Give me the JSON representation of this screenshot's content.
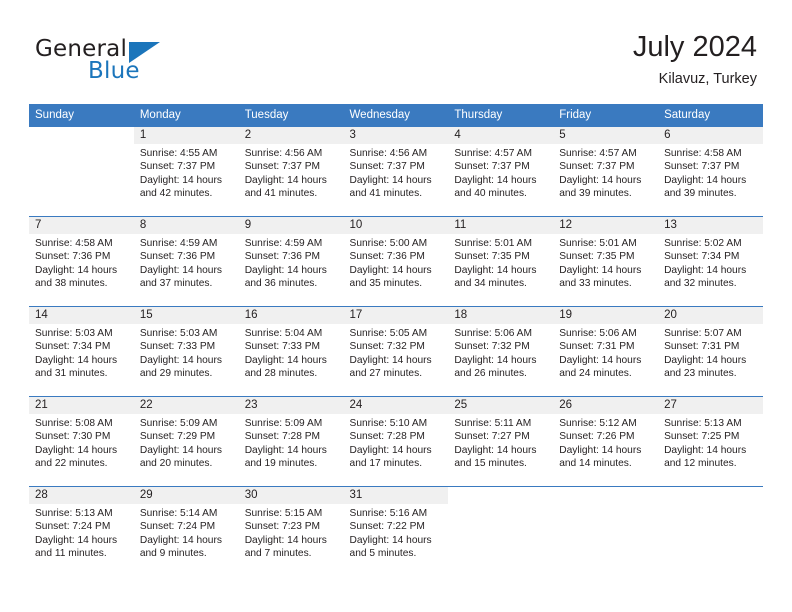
{
  "brand": {
    "word1": "General",
    "word2": "Blue",
    "triangle_color": "#1b75bb"
  },
  "header": {
    "title": "July 2024",
    "location": "Kilavuz, Turkey"
  },
  "theme": {
    "header_blue": "#3a7ac0",
    "daynum_band": "#f0f0f0",
    "text": "#231f20"
  },
  "weekday_headers": [
    "Sunday",
    "Monday",
    "Tuesday",
    "Wednesday",
    "Thursday",
    "Friday",
    "Saturday"
  ],
  "weeks": [
    [
      {
        "day": "",
        "sunrise": "",
        "sunset": "",
        "daylight1": "",
        "daylight2": ""
      },
      {
        "day": "1",
        "sunrise": "Sunrise: 4:55 AM",
        "sunset": "Sunset: 7:37 PM",
        "daylight1": "Daylight: 14 hours",
        "daylight2": "and 42 minutes."
      },
      {
        "day": "2",
        "sunrise": "Sunrise: 4:56 AM",
        "sunset": "Sunset: 7:37 PM",
        "daylight1": "Daylight: 14 hours",
        "daylight2": "and 41 minutes."
      },
      {
        "day": "3",
        "sunrise": "Sunrise: 4:56 AM",
        "sunset": "Sunset: 7:37 PM",
        "daylight1": "Daylight: 14 hours",
        "daylight2": "and 41 minutes."
      },
      {
        "day": "4",
        "sunrise": "Sunrise: 4:57 AM",
        "sunset": "Sunset: 7:37 PM",
        "daylight1": "Daylight: 14 hours",
        "daylight2": "and 40 minutes."
      },
      {
        "day": "5",
        "sunrise": "Sunrise: 4:57 AM",
        "sunset": "Sunset: 7:37 PM",
        "daylight1": "Daylight: 14 hours",
        "daylight2": "and 39 minutes."
      },
      {
        "day": "6",
        "sunrise": "Sunrise: 4:58 AM",
        "sunset": "Sunset: 7:37 PM",
        "daylight1": "Daylight: 14 hours",
        "daylight2": "and 39 minutes."
      }
    ],
    [
      {
        "day": "7",
        "sunrise": "Sunrise: 4:58 AM",
        "sunset": "Sunset: 7:36 PM",
        "daylight1": "Daylight: 14 hours",
        "daylight2": "and 38 minutes."
      },
      {
        "day": "8",
        "sunrise": "Sunrise: 4:59 AM",
        "sunset": "Sunset: 7:36 PM",
        "daylight1": "Daylight: 14 hours",
        "daylight2": "and 37 minutes."
      },
      {
        "day": "9",
        "sunrise": "Sunrise: 4:59 AM",
        "sunset": "Sunset: 7:36 PM",
        "daylight1": "Daylight: 14 hours",
        "daylight2": "and 36 minutes."
      },
      {
        "day": "10",
        "sunrise": "Sunrise: 5:00 AM",
        "sunset": "Sunset: 7:36 PM",
        "daylight1": "Daylight: 14 hours",
        "daylight2": "and 35 minutes."
      },
      {
        "day": "11",
        "sunrise": "Sunrise: 5:01 AM",
        "sunset": "Sunset: 7:35 PM",
        "daylight1": "Daylight: 14 hours",
        "daylight2": "and 34 minutes."
      },
      {
        "day": "12",
        "sunrise": "Sunrise: 5:01 AM",
        "sunset": "Sunset: 7:35 PM",
        "daylight1": "Daylight: 14 hours",
        "daylight2": "and 33 minutes."
      },
      {
        "day": "13",
        "sunrise": "Sunrise: 5:02 AM",
        "sunset": "Sunset: 7:34 PM",
        "daylight1": "Daylight: 14 hours",
        "daylight2": "and 32 minutes."
      }
    ],
    [
      {
        "day": "14",
        "sunrise": "Sunrise: 5:03 AM",
        "sunset": "Sunset: 7:34 PM",
        "daylight1": "Daylight: 14 hours",
        "daylight2": "and 31 minutes."
      },
      {
        "day": "15",
        "sunrise": "Sunrise: 5:03 AM",
        "sunset": "Sunset: 7:33 PM",
        "daylight1": "Daylight: 14 hours",
        "daylight2": "and 29 minutes."
      },
      {
        "day": "16",
        "sunrise": "Sunrise: 5:04 AM",
        "sunset": "Sunset: 7:33 PM",
        "daylight1": "Daylight: 14 hours",
        "daylight2": "and 28 minutes."
      },
      {
        "day": "17",
        "sunrise": "Sunrise: 5:05 AM",
        "sunset": "Sunset: 7:32 PM",
        "daylight1": "Daylight: 14 hours",
        "daylight2": "and 27 minutes."
      },
      {
        "day": "18",
        "sunrise": "Sunrise: 5:06 AM",
        "sunset": "Sunset: 7:32 PM",
        "daylight1": "Daylight: 14 hours",
        "daylight2": "and 26 minutes."
      },
      {
        "day": "19",
        "sunrise": "Sunrise: 5:06 AM",
        "sunset": "Sunset: 7:31 PM",
        "daylight1": "Daylight: 14 hours",
        "daylight2": "and 24 minutes."
      },
      {
        "day": "20",
        "sunrise": "Sunrise: 5:07 AM",
        "sunset": "Sunset: 7:31 PM",
        "daylight1": "Daylight: 14 hours",
        "daylight2": "and 23 minutes."
      }
    ],
    [
      {
        "day": "21",
        "sunrise": "Sunrise: 5:08 AM",
        "sunset": "Sunset: 7:30 PM",
        "daylight1": "Daylight: 14 hours",
        "daylight2": "and 22 minutes."
      },
      {
        "day": "22",
        "sunrise": "Sunrise: 5:09 AM",
        "sunset": "Sunset: 7:29 PM",
        "daylight1": "Daylight: 14 hours",
        "daylight2": "and 20 minutes."
      },
      {
        "day": "23",
        "sunrise": "Sunrise: 5:09 AM",
        "sunset": "Sunset: 7:28 PM",
        "daylight1": "Daylight: 14 hours",
        "daylight2": "and 19 minutes."
      },
      {
        "day": "24",
        "sunrise": "Sunrise: 5:10 AM",
        "sunset": "Sunset: 7:28 PM",
        "daylight1": "Daylight: 14 hours",
        "daylight2": "and 17 minutes."
      },
      {
        "day": "25",
        "sunrise": "Sunrise: 5:11 AM",
        "sunset": "Sunset: 7:27 PM",
        "daylight1": "Daylight: 14 hours",
        "daylight2": "and 15 minutes."
      },
      {
        "day": "26",
        "sunrise": "Sunrise: 5:12 AM",
        "sunset": "Sunset: 7:26 PM",
        "daylight1": "Daylight: 14 hours",
        "daylight2": "and 14 minutes."
      },
      {
        "day": "27",
        "sunrise": "Sunrise: 5:13 AM",
        "sunset": "Sunset: 7:25 PM",
        "daylight1": "Daylight: 14 hours",
        "daylight2": "and 12 minutes."
      }
    ],
    [
      {
        "day": "28",
        "sunrise": "Sunrise: 5:13 AM",
        "sunset": "Sunset: 7:24 PM",
        "daylight1": "Daylight: 14 hours",
        "daylight2": "and 11 minutes."
      },
      {
        "day": "29",
        "sunrise": "Sunrise: 5:14 AM",
        "sunset": "Sunset: 7:24 PM",
        "daylight1": "Daylight: 14 hours",
        "daylight2": "and 9 minutes."
      },
      {
        "day": "30",
        "sunrise": "Sunrise: 5:15 AM",
        "sunset": "Sunset: 7:23 PM",
        "daylight1": "Daylight: 14 hours",
        "daylight2": "and 7 minutes."
      },
      {
        "day": "31",
        "sunrise": "Sunrise: 5:16 AM",
        "sunset": "Sunset: 7:22 PM",
        "daylight1": "Daylight: 14 hours",
        "daylight2": "and 5 minutes."
      },
      {
        "day": "",
        "sunrise": "",
        "sunset": "",
        "daylight1": "",
        "daylight2": ""
      },
      {
        "day": "",
        "sunrise": "",
        "sunset": "",
        "daylight1": "",
        "daylight2": ""
      },
      {
        "day": "",
        "sunrise": "",
        "sunset": "",
        "daylight1": "",
        "daylight2": ""
      }
    ]
  ]
}
